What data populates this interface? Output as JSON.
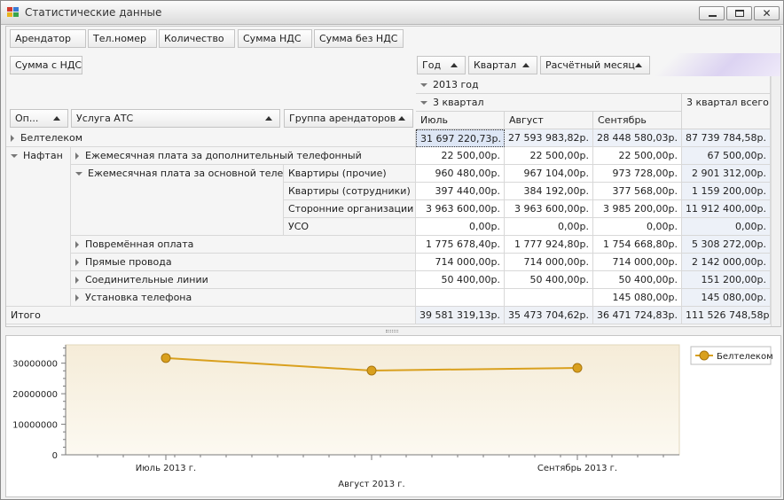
{
  "window": {
    "title": "Статистические данные"
  },
  "filter_fields": [
    "Арендатор",
    "Тел.номер",
    "Количество",
    "Сумма НДС",
    "Сумма без НДС"
  ],
  "data_field": "Сумма с НДС",
  "column_fields": [
    "Год",
    "Квартал",
    "Расчётный месяц"
  ],
  "row_fields": [
    "Оп...",
    "Услуга АТС",
    "Группа арендаторов"
  ],
  "column_headers": {
    "year": "2013 год",
    "quarter": "3 квартал",
    "months": [
      "Июль",
      "Август",
      "Сентябрь"
    ],
    "quarter_total": "3 квартал всего"
  },
  "rows": {
    "beltelecom": {
      "label": "Белтелеком",
      "values": [
        "31 697 220,73р.",
        "27 593 983,82р.",
        "28 448 580,03р.",
        "87 739 784,58р."
      ]
    },
    "naftan": {
      "label": "Нафтан",
      "services": [
        {
          "label": "Ежемесячная плата за дополнительный телефонный",
          "values": [
            "22 500,00р.",
            "22 500,00р.",
            "22 500,00р.",
            "67 500,00р."
          ]
        },
        {
          "label": "Ежемесячная плата за основной телефон",
          "groups": [
            {
              "label": "Квартиры (прочие)",
              "values": [
                "960 480,00р.",
                "967 104,00р.",
                "973 728,00р.",
                "2 901 312,00р."
              ]
            },
            {
              "label": "Квартиры (сотрудники)",
              "values": [
                "397 440,00р.",
                "384 192,00р.",
                "377 568,00р.",
                "1 159 200,00р."
              ]
            },
            {
              "label": "Сторонние организации",
              "values": [
                "3 963 600,00р.",
                "3 963 600,00р.",
                "3 985 200,00р.",
                "11 912 400,00р."
              ]
            },
            {
              "label": "УСО",
              "values": [
                "0,00р.",
                "0,00р.",
                "0,00р.",
                "0,00р."
              ]
            }
          ]
        },
        {
          "label": "Повремённая оплата",
          "values": [
            "1 775 678,40р.",
            "1 777 924,80р.",
            "1 754 668,80р.",
            "5 308 272,00р."
          ]
        },
        {
          "label": "Прямые провода",
          "values": [
            "714 000,00р.",
            "714 000,00р.",
            "714 000,00р.",
            "2 142 000,00р."
          ]
        },
        {
          "label": "Соединительные линии",
          "values": [
            "50 400,00р.",
            "50 400,00р.",
            "50 400,00р.",
            "151 200,00р."
          ]
        },
        {
          "label": "Установка телефона",
          "values": [
            "",
            "",
            "145 080,00р.",
            "145 080,00р."
          ]
        }
      ]
    },
    "total": {
      "label": "Итого",
      "values": [
        "39 581 319,13р.",
        "35 473 704,62р.",
        "36 471 724,83р.",
        "111 526 748,58р."
      ]
    }
  },
  "chart_data": {
    "type": "line",
    "categories": [
      "Июль 2013 г.",
      "Август 2013 г.",
      "Сентябрь 2013 г."
    ],
    "series": [
      {
        "name": "Белтелеком",
        "values": [
          31697220.73,
          27593983.82,
          28448580.03
        ],
        "color": "#d9a01e"
      }
    ],
    "ylim": [
      0,
      36000000
    ],
    "yticks": [
      0,
      10000000,
      20000000,
      30000000
    ],
    "ytick_labels": [
      "0",
      "10000000",
      "20000000",
      "30000000"
    ],
    "legend": "top-right",
    "grid": false
  }
}
